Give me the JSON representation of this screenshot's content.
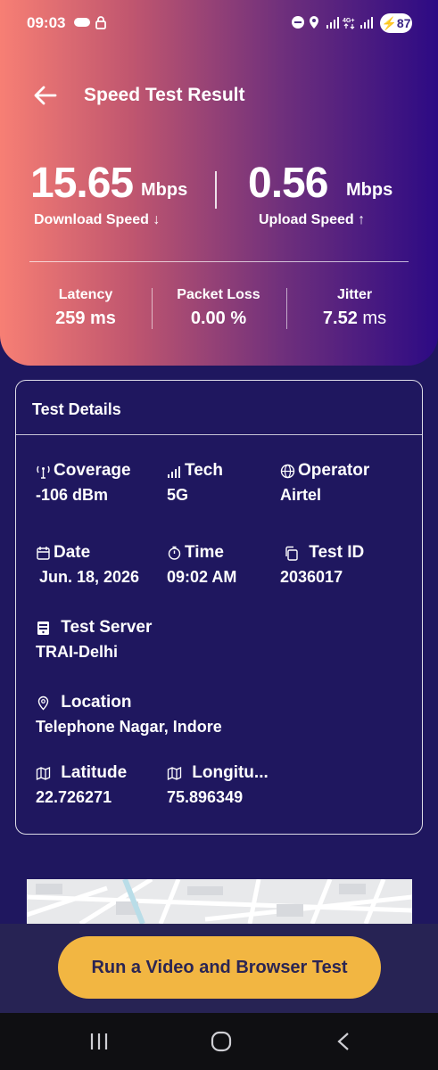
{
  "status_bar": {
    "time": "09:03",
    "battery": "87"
  },
  "header": {
    "title": "Speed Test Result"
  },
  "download": {
    "value": "15.65",
    "unit": "Mbps",
    "label": "Download Speed ↓"
  },
  "upload": {
    "value": "0.56",
    "unit": "Mbps",
    "label": "Upload Speed ↑"
  },
  "metrics": {
    "latency": {
      "label": "Latency",
      "value": "259",
      "unit": "ms"
    },
    "packet_loss": {
      "label": "Packet Loss",
      "value": "0.00",
      "unit": "%"
    },
    "jitter": {
      "label": "Jitter",
      "value": "7.52",
      "unit": "ms"
    }
  },
  "details": {
    "title": "Test Details",
    "coverage": {
      "label": "Coverage",
      "value": "-106 dBm"
    },
    "tech": {
      "label": "Tech",
      "value": "5G"
    },
    "operator": {
      "label": "Operator",
      "value": "Airtel"
    },
    "date": {
      "label": "Date",
      "value": "Jun. 18, 2026"
    },
    "time": {
      "label": "Time",
      "value": "09:02 AM"
    },
    "test_id": {
      "label": "Test ID",
      "value": "2036017"
    },
    "server": {
      "label": "Test Server",
      "value": "TRAI-Delhi"
    },
    "location": {
      "label": "Location",
      "value": "Telephone Nagar, Indore"
    },
    "latitude": {
      "label": "Latitude",
      "value": "22.726271"
    },
    "longitude": {
      "label": "Longitu...",
      "value": "75.896349"
    }
  },
  "cta": {
    "label": "Run a Video and Browser Test"
  },
  "colors": {
    "accent": "#f2b642",
    "background": "#1f175f",
    "hero_start": "#f77f74",
    "hero_end": "#2c0a84"
  }
}
